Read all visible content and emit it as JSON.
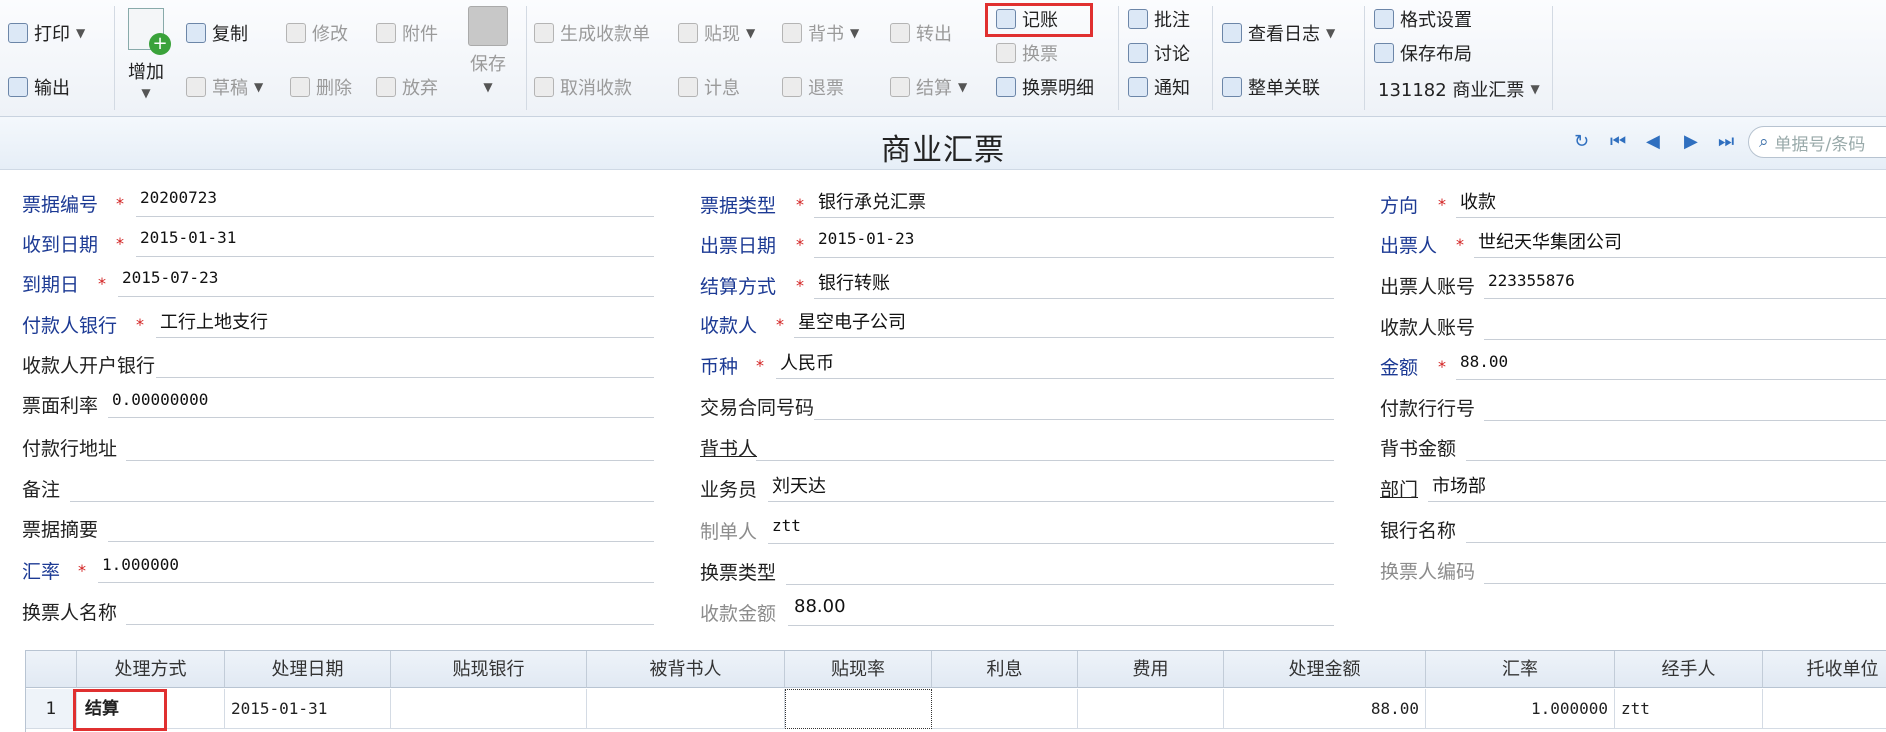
{
  "toolbar": {
    "print": "打印",
    "export": "输出",
    "add": "增加",
    "copy": "复制",
    "draft": "草稿",
    "modify": "修改",
    "delete": "删除",
    "attach": "附件",
    "abandon": "放弃",
    "save": "保存",
    "gen_receipt": "生成收款单",
    "cancel_receipt": "取消收款",
    "discount": "贴现",
    "interest": "计息",
    "endorse": "背书",
    "return_ticket": "退票",
    "transfer_out": "转出",
    "settle": "结算",
    "post": "记账",
    "exchange": "换票",
    "exchange_detail": "换票明细",
    "annotate": "批注",
    "discuss": "讨论",
    "notify": "通知",
    "view_log": "查看日志",
    "doc_link": "整单关联",
    "format_settings": "格式设置",
    "save_layout": "保存布局",
    "template": "131182 商业汇票"
  },
  "title": "商业汇票",
  "search_placeholder": "单据号/条码",
  "fields": {
    "bill_no": {
      "label": "票据编号",
      "value": "20200723"
    },
    "receive_date": {
      "label": "收到日期",
      "value": "2015-01-31"
    },
    "due_date": {
      "label": "到期日",
      "value": "2015-07-23"
    },
    "payer_bank": {
      "label": "付款人银行",
      "value": "工行上地支行"
    },
    "payee_open_bank": {
      "label": "收款人开户银行",
      "value": ""
    },
    "face_rate": {
      "label": "票面利率",
      "value": "0.00000000"
    },
    "payer_bank_addr": {
      "label": "付款行地址",
      "value": ""
    },
    "remark": {
      "label": "备注",
      "value": ""
    },
    "summary": {
      "label": "票据摘要",
      "value": ""
    },
    "exchange_rate": {
      "label": "汇率",
      "value": "1.000000"
    },
    "exchanger_name": {
      "label": "换票人名称",
      "value": ""
    },
    "bill_type": {
      "label": "票据类型",
      "value": "银行承兑汇票"
    },
    "issue_date": {
      "label": "出票日期",
      "value": "2015-01-23"
    },
    "settle_method": {
      "label": "结算方式",
      "value": "银行转账"
    },
    "payee": {
      "label": "收款人",
      "value": "星空电子公司"
    },
    "currency": {
      "label": "币种",
      "value": "人民币"
    },
    "contract_no": {
      "label": "交易合同号码",
      "value": ""
    },
    "endorser": {
      "label": "背书人",
      "value": ""
    },
    "salesman": {
      "label": "业务员",
      "value": "刘天达"
    },
    "maker": {
      "label": "制单人",
      "value": "ztt"
    },
    "exchange_type": {
      "label": "换票类型",
      "value": ""
    },
    "receipt_amount": {
      "label": "收款金额",
      "value": "88.00"
    },
    "direction": {
      "label": "方向",
      "value": "收款"
    },
    "drawer": {
      "label": "出票人",
      "value": "世纪天华集团公司"
    },
    "drawer_account": {
      "label": "出票人账号",
      "value": "223355876"
    },
    "payee_account": {
      "label": "收款人账号",
      "value": ""
    },
    "amount": {
      "label": "金额",
      "value": "88.00"
    },
    "payer_bank_no": {
      "label": "付款行行号",
      "value": ""
    },
    "endorse_amount": {
      "label": "背书金额",
      "value": ""
    },
    "department": {
      "label": "部门",
      "value": "市场部"
    },
    "bank_name": {
      "label": "银行名称",
      "value": ""
    },
    "exchanger_code": {
      "label": "换票人编码",
      "value": ""
    }
  },
  "grid": {
    "headers": [
      "处理方式",
      "处理日期",
      "贴现银行",
      "被背书人",
      "贴现率",
      "利息",
      "费用",
      "处理金额",
      "汇率",
      "经手人",
      "托收单位"
    ],
    "rows": [
      {
        "no": "1",
        "method": "结算",
        "date": "2015-01-31",
        "bank": "",
        "endorsee": "",
        "rate": "",
        "interest": "",
        "fee": "",
        "amount": "88.00",
        "fx": "1.000000",
        "handler": "ztt",
        "unit": ""
      }
    ]
  }
}
